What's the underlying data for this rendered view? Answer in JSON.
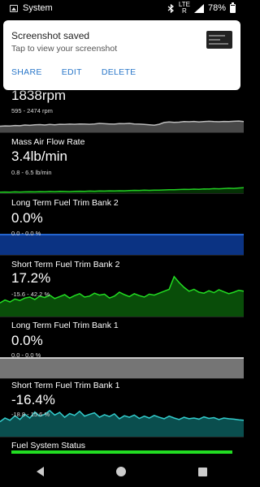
{
  "status_bar": {
    "app_name": "System",
    "network_top": "LTE",
    "network_bottom": "R",
    "battery": "78%"
  },
  "notification": {
    "title": "Screenshot saved",
    "subtitle": "Tap to view your screenshot",
    "actions": [
      "SHARE",
      "EDIT",
      "DELETE"
    ]
  },
  "gauges": [
    {
      "label": "",
      "value": "1838rpm",
      "range": "595 - 2474 rpm",
      "line_color": "#bbbbbb",
      "fill_color": "#555555",
      "series": [
        0.34,
        0.36,
        0.35,
        0.38,
        0.37,
        0.41,
        0.39,
        0.42,
        0.43,
        0.41,
        0.44,
        0.42,
        0.45,
        0.44,
        0.46,
        0.45,
        0.47,
        0.46,
        0.45,
        0.47,
        0.5,
        0.48,
        0.47,
        0.46,
        0.49,
        0.48,
        0.5,
        0.47,
        0.46,
        0.44,
        0.42,
        0.4,
        0.45,
        0.55,
        0.58,
        0.56,
        0.57,
        0.6,
        0.59,
        0.61,
        0.58,
        0.6,
        0.62,
        0.6,
        0.59,
        0.61,
        0.6,
        0.62,
        0.63,
        0.6
      ]
    },
    {
      "label": "Mass Air Flow Rate",
      "value": "3.4lb/min",
      "range": "0.8 - 6.5 lb/min",
      "line_color": "#22cc22",
      "fill_color": "#063a06",
      "series": [
        0.08,
        0.09,
        0.08,
        0.1,
        0.09,
        0.1,
        0.11,
        0.1,
        0.12,
        0.11,
        0.13,
        0.12,
        0.14,
        0.13,
        0.12,
        0.14,
        0.15,
        0.14,
        0.16,
        0.15,
        0.17,
        0.16,
        0.18,
        0.17,
        0.19,
        0.18,
        0.2,
        0.22,
        0.21,
        0.23,
        0.22,
        0.24,
        0.23,
        0.25,
        0.27,
        0.26,
        0.28,
        0.3,
        0.29,
        0.31,
        0.3,
        0.33,
        0.32,
        0.35,
        0.34,
        0.36,
        0.38,
        0.37,
        0.4,
        0.42
      ]
    },
    {
      "label": "Long Term Fuel Trim Bank 2",
      "value": "0.0%",
      "range": "0.0 - 0.0 %",
      "line_color": "#2f7fff",
      "fill_color": "#0d3c9a",
      "series": [
        0.5,
        0.5,
        0.5,
        0.5,
        0.5,
        0.5,
        0.5,
        0.5,
        0.5,
        0.5,
        0.5,
        0.5,
        0.5,
        0.5,
        0.5,
        0.5,
        0.5,
        0.5,
        0.5,
        0.5,
        0.5,
        0.5,
        0.5,
        0.5,
        0.5,
        0.5,
        0.5,
        0.5,
        0.5,
        0.5,
        0.5,
        0.5,
        0.5,
        0.5,
        0.5,
        0.5,
        0.5,
        0.5,
        0.5,
        0.5,
        0.5,
        0.5,
        0.5,
        0.5,
        0.5,
        0.5,
        0.5,
        0.5,
        0.5,
        0.5
      ]
    },
    {
      "label": "Short Term Fuel Trim Bank 2",
      "value": "17.2%",
      "range": "-15.6 - 42.2 %",
      "line_color": "#22dd22",
      "fill_color": "#0b5b0b",
      "series": [
        0.28,
        0.34,
        0.3,
        0.36,
        0.33,
        0.38,
        0.4,
        0.35,
        0.42,
        0.39,
        0.44,
        0.37,
        0.41,
        0.45,
        0.38,
        0.43,
        0.47,
        0.4,
        0.42,
        0.48,
        0.44,
        0.46,
        0.38,
        0.42,
        0.5,
        0.45,
        0.41,
        0.47,
        0.43,
        0.4,
        0.46,
        0.44,
        0.48,
        0.52,
        0.56,
        0.82,
        0.7,
        0.6,
        0.52,
        0.56,
        0.5,
        0.48,
        0.53,
        0.49,
        0.55,
        0.51,
        0.47,
        0.5,
        0.54,
        0.52
      ]
    },
    {
      "label": "Long Term Fuel Trim Bank 1",
      "value": "0.0%",
      "range": "0.0 - 0.0 %",
      "line_color": "#f2f2f2",
      "fill_color": "#8a8a8a",
      "series": [
        0.5,
        0.5,
        0.5,
        0.5,
        0.5,
        0.5,
        0.5,
        0.5,
        0.5,
        0.5,
        0.5,
        0.5,
        0.5,
        0.5,
        0.5,
        0.5,
        0.5,
        0.5,
        0.5,
        0.5,
        0.5,
        0.5,
        0.5,
        0.5,
        0.5,
        0.5,
        0.5,
        0.5,
        0.5,
        0.5,
        0.5,
        0.5,
        0.5,
        0.5,
        0.5,
        0.5,
        0.5,
        0.5,
        0.5,
        0.5,
        0.5,
        0.5,
        0.5,
        0.5,
        0.5,
        0.5,
        0.5,
        0.5,
        0.5,
        0.5
      ]
    },
    {
      "label": "Short Term Fuel Trim Bank 1",
      "value": "-16.4%",
      "range": "-18.8 - 15.6 %",
      "line_color": "#33cccc",
      "fill_color": "#0c5c5c",
      "series": [
        0.4,
        0.5,
        0.44,
        0.56,
        0.46,
        0.6,
        0.5,
        0.66,
        0.55,
        0.6,
        0.7,
        0.58,
        0.65,
        0.52,
        0.62,
        0.57,
        0.68,
        0.55,
        0.6,
        0.64,
        0.52,
        0.59,
        0.54,
        0.61,
        0.48,
        0.56,
        0.52,
        0.58,
        0.49,
        0.55,
        0.5,
        0.57,
        0.52,
        0.48,
        0.55,
        0.5,
        0.46,
        0.52,
        0.48,
        0.5,
        0.47,
        0.53,
        0.49,
        0.51,
        0.46,
        0.5,
        0.48,
        0.47,
        0.45,
        0.44
      ]
    },
    {
      "label": "Fuel System Status",
      "value": "",
      "range": "",
      "line_color": "#22dd22",
      "fill_color": "#22dd22",
      "series": []
    }
  ]
}
